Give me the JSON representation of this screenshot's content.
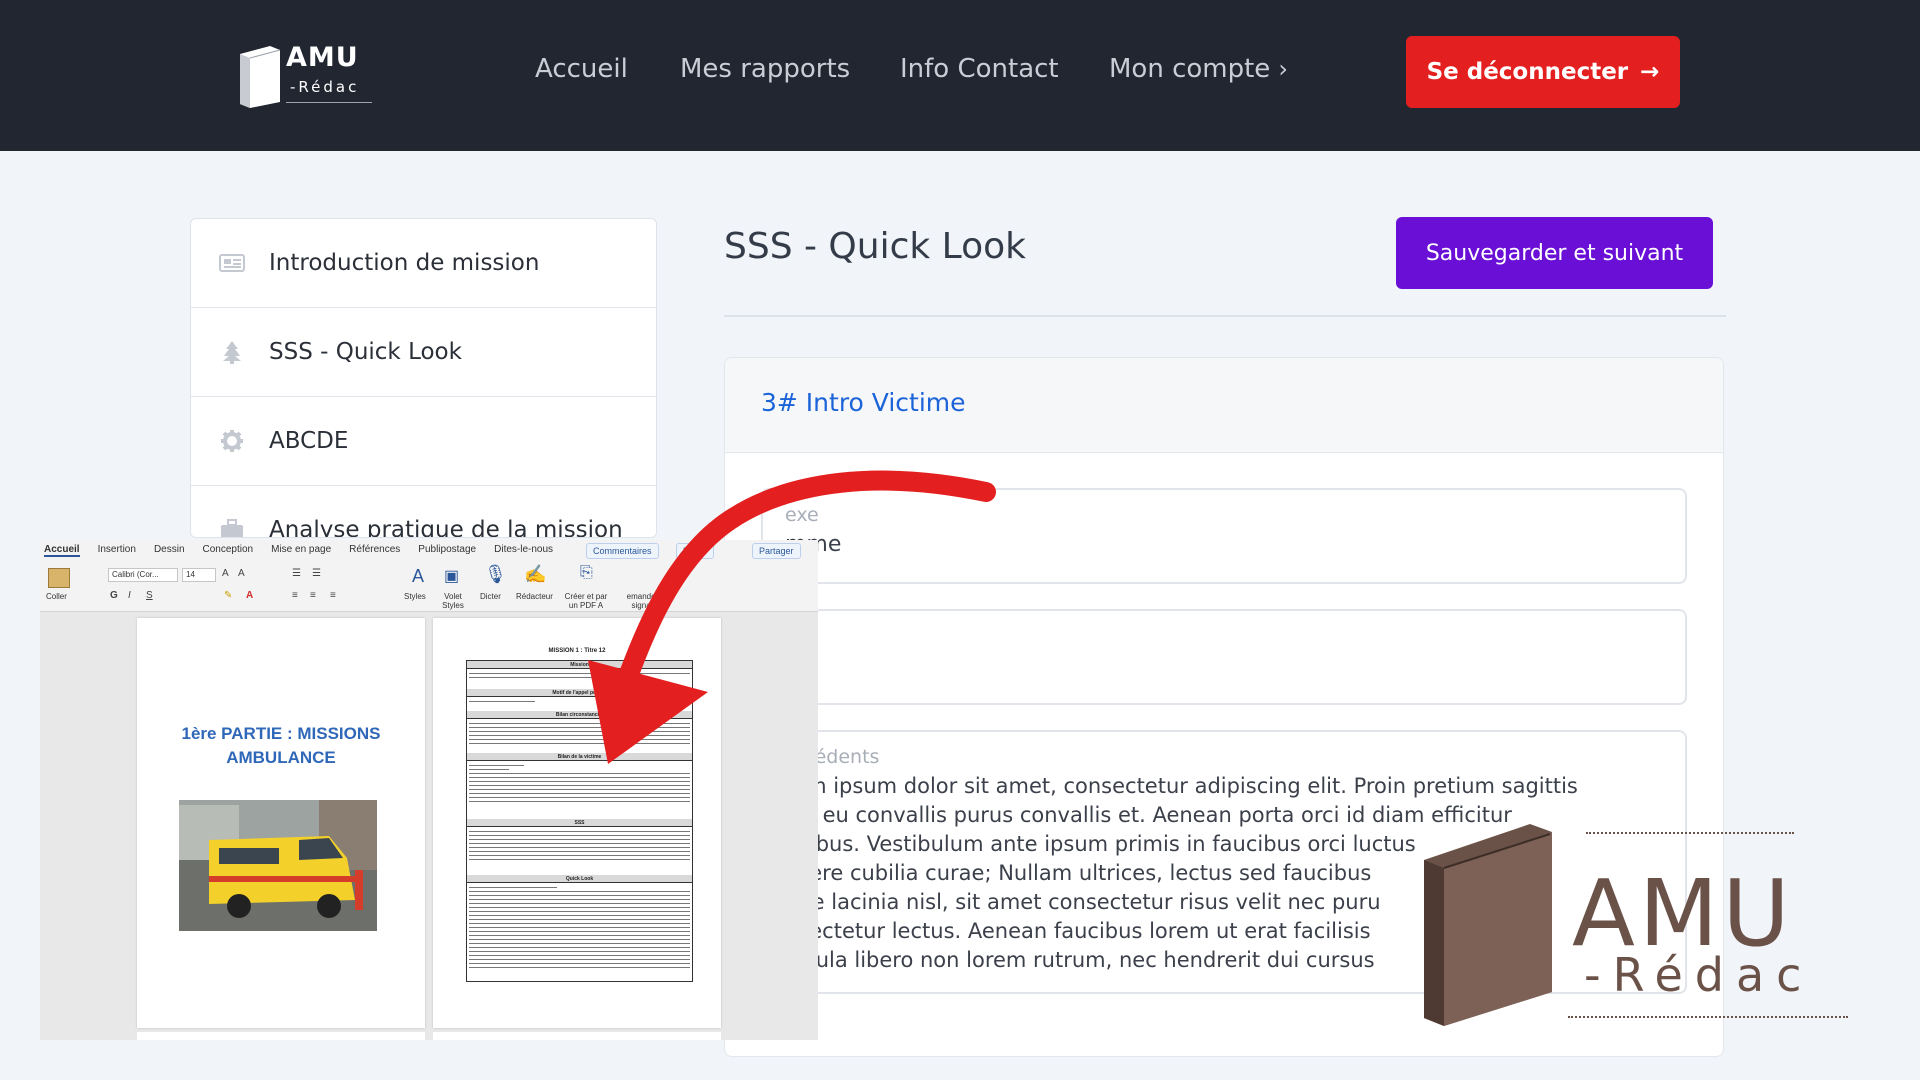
{
  "header": {
    "logo": {
      "amu": "AMU",
      "redac": "-Rédac"
    },
    "nav": [
      {
        "label": "Accueil"
      },
      {
        "label": "Mes rapports"
      },
      {
        "label": "Info Contact"
      },
      {
        "label": "Mon compte"
      }
    ],
    "logout_label": "Se déconnecter",
    "logout_color": "#e41f1f"
  },
  "sidebar": {
    "items": [
      {
        "label": "Introduction de mission",
        "icon": "newspaper-icon"
      },
      {
        "label": "SSS - Quick Look",
        "icon": "pine-tree-icon"
      },
      {
        "label": "ABCDE",
        "icon": "gear-icon"
      },
      {
        "label": "Analyse pratique de la mission",
        "icon": "briefcase-icon"
      }
    ]
  },
  "main": {
    "title": "SSS - Quick Look",
    "save_label": "Sauvegarder et suivant",
    "save_color": "#6a0fd6",
    "card": {
      "title": "3# Intro Victime",
      "title_color": "#1b63d8",
      "fields": [
        {
          "label": "exe",
          "value": "mme"
        },
        {
          "label": "e",
          "value": ""
        },
        {
          "label": "técédents",
          "value": "rem ipsum dolor sit amet, consectetur adipiscing elit. Proin pretium sagittis\nus, eu convallis purus convallis et. Aenean porta orci id diam efficitur\nucibus. Vestibulum ante ipsum primis in faucibus orci luctus\nsuere cubilia curae; Nullam ultrices, lectus sed faucibus\ngue lacinia nisl, sit amet consectetur risus velit nec puru\nnsectetur lectus. Aenean faucibus lorem ut erat facilisis\nhicula libero non lorem rutrum, nec hendrerit dui cursus"
        }
      ]
    }
  },
  "word_doc": {
    "tabs": [
      "Accueil",
      "Insertion",
      "Dessin",
      "Conception",
      "Mise en page",
      "Références",
      "Publipostage",
      "Dites-le-nous"
    ],
    "comments_label": "Commentaires",
    "modify_label": "Modifi",
    "share_label": "Partager",
    "font_name": "Calibri (Cor...",
    "font_size": "14",
    "tools": {
      "paste": "Coller",
      "styles": "Styles",
      "styles_pane": "Volet Styles",
      "dictate": "Dicter",
      "editor": "Rédacteur",
      "pdf": "Créer et par un PDF A",
      "signatures": "emander des signatures"
    },
    "page1": {
      "heading_line1": "1ère PARTIE : MISSIONS",
      "heading_line2": "AMBULANCE"
    },
    "page2": {
      "title": "MISSION 1 : Titre 12",
      "sections": [
        "Mission",
        "Motif de l'appel pour la",
        "Bilan circonstanciel",
        "Bilan de la victime",
        "SSS",
        "Quick Look"
      ]
    }
  },
  "watermark": {
    "amu": "AMU",
    "redac": "-Rédac"
  }
}
